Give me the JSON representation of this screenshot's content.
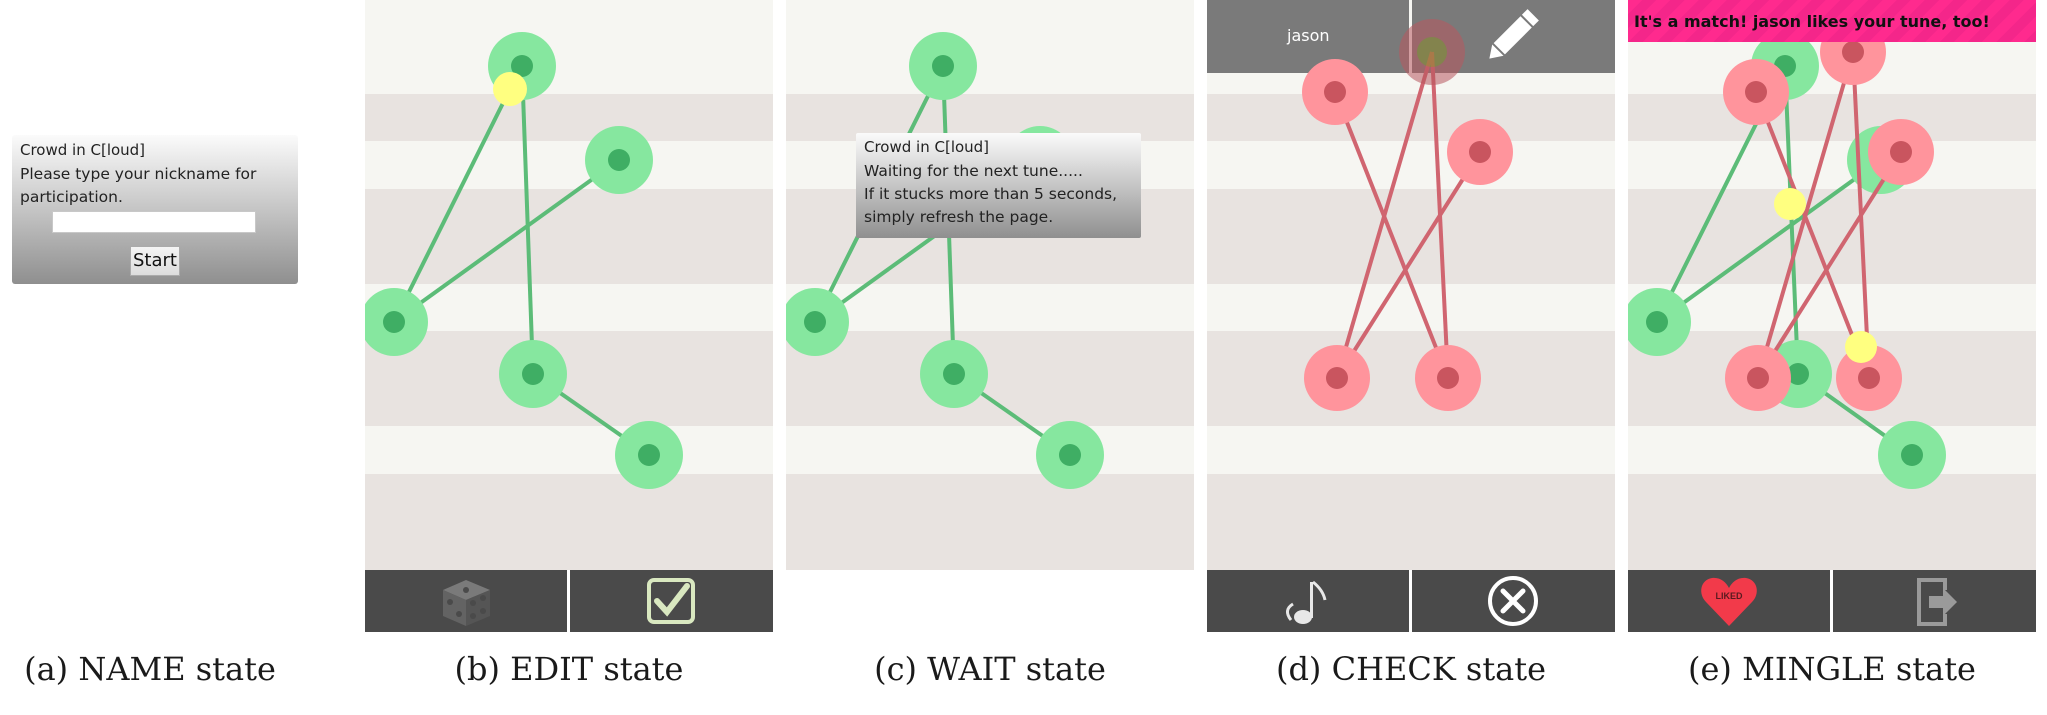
{
  "name_state": {
    "dialog_title": "Crowd in C[loud]",
    "dialog_line1": "Please type your nickname for",
    "dialog_line2": "participation.",
    "nickname_value": "",
    "start_label": "Start",
    "caption": "(a) NAME state"
  },
  "edit_state": {
    "caption": "(b) EDIT state",
    "bottom_buttons": [
      "dice-icon",
      "checkbox-icon"
    ]
  },
  "wait_state": {
    "dialog_title": "Crowd in C[loud]",
    "dialog_line1": "Waiting for the next tune.....",
    "dialog_line2": "If it stucks more than 5 seconds,",
    "dialog_line3": "simply refresh the page.",
    "caption": "(c) WAIT state"
  },
  "check_state": {
    "user_name": "jason",
    "caption": "(d) CHECK state",
    "top_buttons": [
      "user-name",
      "pencil-icon"
    ],
    "bottom_buttons": [
      "music-note-icon",
      "close-circle-icon"
    ]
  },
  "mingle_state": {
    "match_message": "It's a match! jason likes your tune, too!",
    "liked_label": "LIKED",
    "caption": "(e) MINGLE state",
    "bottom_buttons": [
      "heart-liked-icon",
      "exit-icon"
    ]
  },
  "colors": {
    "stripe_light": "#f6f6f2",
    "stripe_dark": "#e8e3e0",
    "green_node": "#86e79f",
    "green_dot": "#3fae64",
    "green_line": "#5cbc78",
    "red_node": "#ff949c",
    "red_dot": "#c9555f",
    "red_line": "#d06570",
    "cursor_yellow": "#ffff80",
    "bar_dark": "#4a4a4a",
    "top_grey": "#7a7a7a",
    "match_pink": "#ff2a8e"
  }
}
